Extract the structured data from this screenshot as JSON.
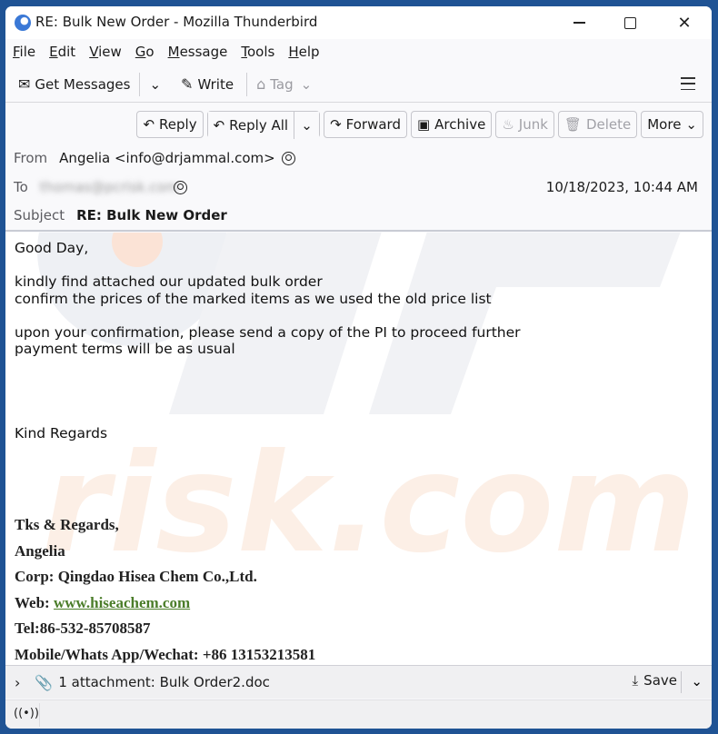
{
  "window": {
    "title": "RE: Bulk New Order - Mozilla Thunderbird",
    "controls": {
      "minimize": "minimize",
      "maximize": "maximize",
      "close": "✕"
    }
  },
  "menubar": {
    "items": [
      {
        "label_u": "F",
        "label_rest": "ile"
      },
      {
        "label_u": "E",
        "label_rest": "dit"
      },
      {
        "label_u": "V",
        "label_rest": "iew"
      },
      {
        "label_u": "G",
        "label_rest": "o"
      },
      {
        "label_u": "M",
        "label_rest": "essage"
      },
      {
        "label_u": "T",
        "label_rest": "ools"
      },
      {
        "label_u": "H",
        "label_rest": "elp"
      }
    ]
  },
  "toolbar": {
    "get_messages": "Get Messages",
    "write": "Write",
    "tag": "Tag",
    "icons": {
      "get_messages": "✉",
      "write": "✎",
      "tag": "⌂",
      "chevron": "⌄"
    }
  },
  "message_actions": {
    "reply": "Reply",
    "reply_all": "Reply All",
    "forward": "Forward",
    "archive": "Archive",
    "junk": "Junk",
    "delete": "Delete",
    "more": "More",
    "icons": {
      "reply": "↶",
      "reply_all": "↶",
      "forward": "↷",
      "archive": "▣",
      "junk": "♨",
      "delete": "🗑",
      "caret": "⌄"
    }
  },
  "header": {
    "from_label": "From",
    "from_value": "Angelia <info@drjammal.com>",
    "to_label": "To",
    "to_value": "thomas@pcrisk.com",
    "subject_label": "Subject",
    "subject_value": "RE: Bulk New Order",
    "date": "10/18/2023, 10:44 AM"
  },
  "body": {
    "greeting": "Good Day,",
    "line1": "kindly find attached our updated bulk order",
    "line2": "confirm the prices of the marked items as we used the old price list",
    "line3": "upon your confirmation, please send a copy of the PI to proceed further",
    "line4": "payment terms will be as usual",
    "closing": "Kind Regards"
  },
  "signature": {
    "thanks": "Tks & Regards,",
    "name": "Angelia",
    "corp": "Corp: Qingdao Hisea Chem Co.,Ltd.",
    "web_label": "Web: ",
    "web_link": " www.hiseachem.com",
    "tel": "Tel:86-532-85708587",
    "mobile": "Mobile/Whats App/Wechat: +86 13153213581"
  },
  "attachments": {
    "summary": "1 attachment: Bulk Order2.doc",
    "save_label": "Save",
    "icons": {
      "toggle": "›",
      "clip": "📎",
      "save": "⤓",
      "caret": "⌄"
    }
  },
  "statusbar": {
    "icon": "((•))"
  },
  "colors": {
    "desktop": "#1f5394",
    "link_green": "#4b7d2a",
    "watermark_gray": "#e8e8ec",
    "watermark_orange": "#fbe6d8"
  }
}
